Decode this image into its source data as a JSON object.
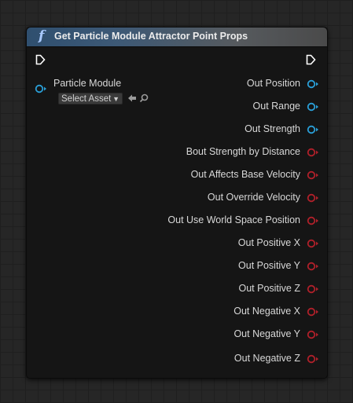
{
  "node": {
    "title": "Get Particle Module Attractor Point Props",
    "header_icon": "function-icon",
    "header_icon_glyph": "f",
    "input": {
      "label": "Particle Module",
      "asset_picker": "Select Asset",
      "use_icon": "arrow-left-icon",
      "browse_icon": "search-icon"
    },
    "outputs": [
      {
        "label": "Out Position",
        "type": "vector",
        "color": "#2a9fd8"
      },
      {
        "label": "Out Range",
        "type": "vector",
        "color": "#2a9fd8"
      },
      {
        "label": "Out Strength",
        "type": "vector",
        "color": "#2a9fd8"
      },
      {
        "label": "Bout Strength by Distance",
        "type": "bool",
        "color": "#b0202a"
      },
      {
        "label": "Out Affects Base Velocity",
        "type": "bool",
        "color": "#b0202a"
      },
      {
        "label": "Out Override Velocity",
        "type": "bool",
        "color": "#b0202a"
      },
      {
        "label": "Out Use World Space Position",
        "type": "bool",
        "color": "#b0202a"
      },
      {
        "label": "Out Positive X",
        "type": "bool",
        "color": "#b0202a"
      },
      {
        "label": "Out Positive Y",
        "type": "bool",
        "color": "#b0202a"
      },
      {
        "label": "Out Positive Z",
        "type": "bool",
        "color": "#b0202a"
      },
      {
        "label": "Out Negative X",
        "type": "bool",
        "color": "#b0202a"
      },
      {
        "label": "Out Negative Y",
        "type": "bool",
        "color": "#b0202a"
      },
      {
        "label": "Out Negative Z",
        "type": "bool",
        "color": "#b0202a"
      }
    ]
  }
}
